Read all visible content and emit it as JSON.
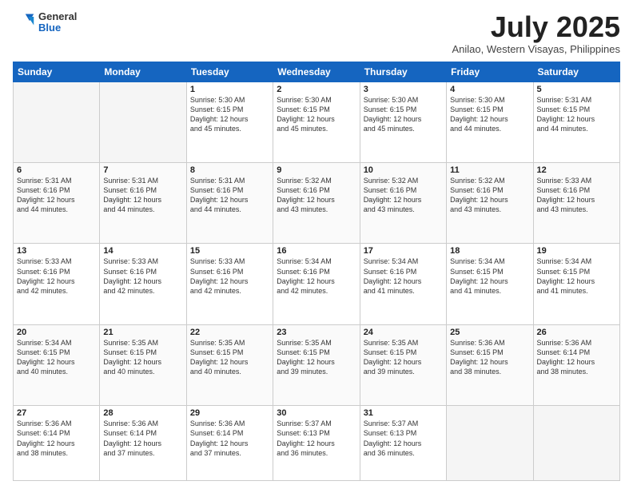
{
  "header": {
    "logo_general": "General",
    "logo_blue": "Blue",
    "month_year": "July 2025",
    "location": "Anilao, Western Visayas, Philippines"
  },
  "weekdays": [
    "Sunday",
    "Monday",
    "Tuesday",
    "Wednesday",
    "Thursday",
    "Friday",
    "Saturday"
  ],
  "weeks": [
    [
      {
        "day": "",
        "text": ""
      },
      {
        "day": "",
        "text": ""
      },
      {
        "day": "1",
        "text": "Sunrise: 5:30 AM\nSunset: 6:15 PM\nDaylight: 12 hours\nand 45 minutes."
      },
      {
        "day": "2",
        "text": "Sunrise: 5:30 AM\nSunset: 6:15 PM\nDaylight: 12 hours\nand 45 minutes."
      },
      {
        "day": "3",
        "text": "Sunrise: 5:30 AM\nSunset: 6:15 PM\nDaylight: 12 hours\nand 45 minutes."
      },
      {
        "day": "4",
        "text": "Sunrise: 5:30 AM\nSunset: 6:15 PM\nDaylight: 12 hours\nand 44 minutes."
      },
      {
        "day": "5",
        "text": "Sunrise: 5:31 AM\nSunset: 6:15 PM\nDaylight: 12 hours\nand 44 minutes."
      }
    ],
    [
      {
        "day": "6",
        "text": "Sunrise: 5:31 AM\nSunset: 6:16 PM\nDaylight: 12 hours\nand 44 minutes."
      },
      {
        "day": "7",
        "text": "Sunrise: 5:31 AM\nSunset: 6:16 PM\nDaylight: 12 hours\nand 44 minutes."
      },
      {
        "day": "8",
        "text": "Sunrise: 5:31 AM\nSunset: 6:16 PM\nDaylight: 12 hours\nand 44 minutes."
      },
      {
        "day": "9",
        "text": "Sunrise: 5:32 AM\nSunset: 6:16 PM\nDaylight: 12 hours\nand 43 minutes."
      },
      {
        "day": "10",
        "text": "Sunrise: 5:32 AM\nSunset: 6:16 PM\nDaylight: 12 hours\nand 43 minutes."
      },
      {
        "day": "11",
        "text": "Sunrise: 5:32 AM\nSunset: 6:16 PM\nDaylight: 12 hours\nand 43 minutes."
      },
      {
        "day": "12",
        "text": "Sunrise: 5:33 AM\nSunset: 6:16 PM\nDaylight: 12 hours\nand 43 minutes."
      }
    ],
    [
      {
        "day": "13",
        "text": "Sunrise: 5:33 AM\nSunset: 6:16 PM\nDaylight: 12 hours\nand 42 minutes."
      },
      {
        "day": "14",
        "text": "Sunrise: 5:33 AM\nSunset: 6:16 PM\nDaylight: 12 hours\nand 42 minutes."
      },
      {
        "day": "15",
        "text": "Sunrise: 5:33 AM\nSunset: 6:16 PM\nDaylight: 12 hours\nand 42 minutes."
      },
      {
        "day": "16",
        "text": "Sunrise: 5:34 AM\nSunset: 6:16 PM\nDaylight: 12 hours\nand 42 minutes."
      },
      {
        "day": "17",
        "text": "Sunrise: 5:34 AM\nSunset: 6:16 PM\nDaylight: 12 hours\nand 41 minutes."
      },
      {
        "day": "18",
        "text": "Sunrise: 5:34 AM\nSunset: 6:15 PM\nDaylight: 12 hours\nand 41 minutes."
      },
      {
        "day": "19",
        "text": "Sunrise: 5:34 AM\nSunset: 6:15 PM\nDaylight: 12 hours\nand 41 minutes."
      }
    ],
    [
      {
        "day": "20",
        "text": "Sunrise: 5:34 AM\nSunset: 6:15 PM\nDaylight: 12 hours\nand 40 minutes."
      },
      {
        "day": "21",
        "text": "Sunrise: 5:35 AM\nSunset: 6:15 PM\nDaylight: 12 hours\nand 40 minutes."
      },
      {
        "day": "22",
        "text": "Sunrise: 5:35 AM\nSunset: 6:15 PM\nDaylight: 12 hours\nand 40 minutes."
      },
      {
        "day": "23",
        "text": "Sunrise: 5:35 AM\nSunset: 6:15 PM\nDaylight: 12 hours\nand 39 minutes."
      },
      {
        "day": "24",
        "text": "Sunrise: 5:35 AM\nSunset: 6:15 PM\nDaylight: 12 hours\nand 39 minutes."
      },
      {
        "day": "25",
        "text": "Sunrise: 5:36 AM\nSunset: 6:15 PM\nDaylight: 12 hours\nand 38 minutes."
      },
      {
        "day": "26",
        "text": "Sunrise: 5:36 AM\nSunset: 6:14 PM\nDaylight: 12 hours\nand 38 minutes."
      }
    ],
    [
      {
        "day": "27",
        "text": "Sunrise: 5:36 AM\nSunset: 6:14 PM\nDaylight: 12 hours\nand 38 minutes."
      },
      {
        "day": "28",
        "text": "Sunrise: 5:36 AM\nSunset: 6:14 PM\nDaylight: 12 hours\nand 37 minutes."
      },
      {
        "day": "29",
        "text": "Sunrise: 5:36 AM\nSunset: 6:14 PM\nDaylight: 12 hours\nand 37 minutes."
      },
      {
        "day": "30",
        "text": "Sunrise: 5:37 AM\nSunset: 6:13 PM\nDaylight: 12 hours\nand 36 minutes."
      },
      {
        "day": "31",
        "text": "Sunrise: 5:37 AM\nSunset: 6:13 PM\nDaylight: 12 hours\nand 36 minutes."
      },
      {
        "day": "",
        "text": ""
      },
      {
        "day": "",
        "text": ""
      }
    ]
  ]
}
